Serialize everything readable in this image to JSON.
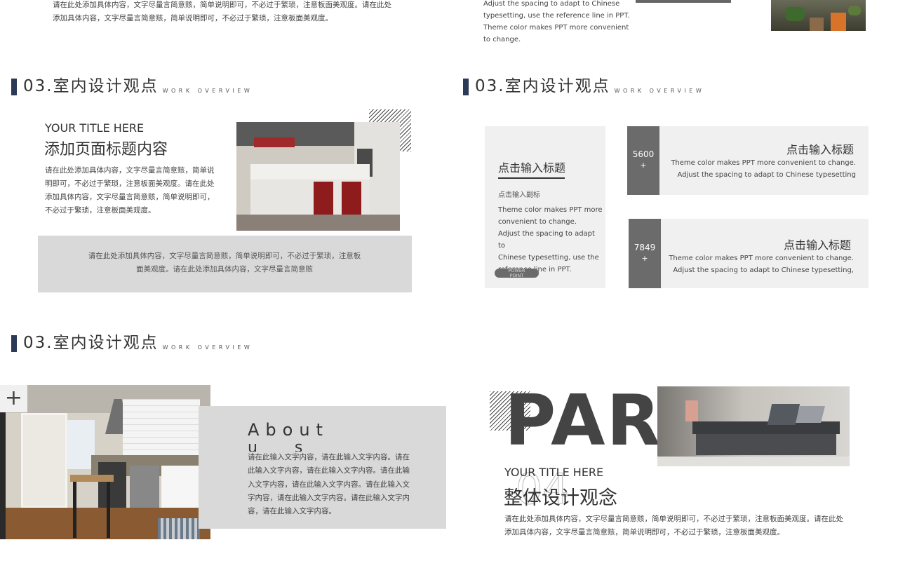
{
  "colors": {
    "accent": "#2c3a57",
    "gray_box": "#d9d9d9",
    "light_box": "#f0f0f0",
    "dark_box": "#6b6b6b",
    "part_text": "#444444"
  },
  "top_left": {
    "line1": "请在此处添加具体内容，文字尽量言简意赅，简单说明即可，不必过于繁琐，注意板面美观度。请在此处",
    "line2": "添加具体内容，文字尽量言简意赅，简单说明即可，不必过于繁琐，注意板面美观度。"
  },
  "top_right": {
    "lines": [
      "Adjust the spacing to adapt to Chinese",
      "typesetting, use the reference line in PPT.",
      "Theme color makes PPT more convenient",
      "to change."
    ]
  },
  "section_header": {
    "number": "03.",
    "title": "室内设计观点",
    "subtitle": "WORK OVERVIEW"
  },
  "slide_a": {
    "eyebrow": "YOUR TITLE HERE",
    "heading": "添加页面标题内容",
    "body": [
      "请在此处添加具体内容，文字尽量言简意赅，简单说",
      "明即可，不必过于繁琐，注意板面美观度。请在此处",
      "添加具体内容，文字尽量言简意赅，简单说明即可，",
      "不必过于繁琐，注意板面美观度。"
    ],
    "box_lines": [
      "请在此处添加具体内容，文字尽量言简意赅，简单说明即可，不必过于繁琐，注意板",
      "面美观度。请在此处添加具体内容，文字尽量言简意赅"
    ]
  },
  "slide_b": {
    "card_title": "点击输入标题",
    "card_subtitle": "点击输入副标",
    "card_body": [
      "Theme color makes PPT more",
      "convenient to change.",
      "Adjust the spacing to adapt to",
      "Chinese typesetting, use the",
      "reference line in PPT."
    ],
    "pill_line1": "POWER",
    "pill_line2": "POINT",
    "stat1": {
      "number": "5600",
      "plus": "+",
      "title": "点击输入标题",
      "line1": "Theme color makes PPT more convenient to change.",
      "line2": "Adjust the spacing to adapt to Chinese typesetting"
    },
    "stat2": {
      "number": "7849",
      "plus": "+",
      "title": "点击输入标题",
      "line1": "Theme color makes PPT more convenient to change.",
      "line2": "Adjust the spacing to adapt to Chinese typesetting,"
    }
  },
  "slide_c": {
    "plus": "+",
    "about_line1": "About",
    "about_line2": "u     s",
    "body": [
      "请在此输入文字内容，请在此输入文字内容。请在",
      "此输入文字内容，请在此输入文字内容。请在此输",
      "入文字内容，请在此输入文字内容。请在此输入文",
      "字内容，请在此输入文字内容。请在此输入文字内",
      "容，请在此输入文字内容。"
    ]
  },
  "slide_d": {
    "big_word": "PART",
    "number": "04",
    "eyebrow": "YOUR TITLE HERE",
    "heading": "整体设计观念",
    "line1": "请在此处添加具体内容，文字尽量言简意赅，简单说明即可，不必过于繁琐，注意板面美观度。请在此处",
    "line2": "添加具体内容，文字尽量言简意赅，简单说明即可，不必过于繁琐，注意板面美观度。"
  }
}
